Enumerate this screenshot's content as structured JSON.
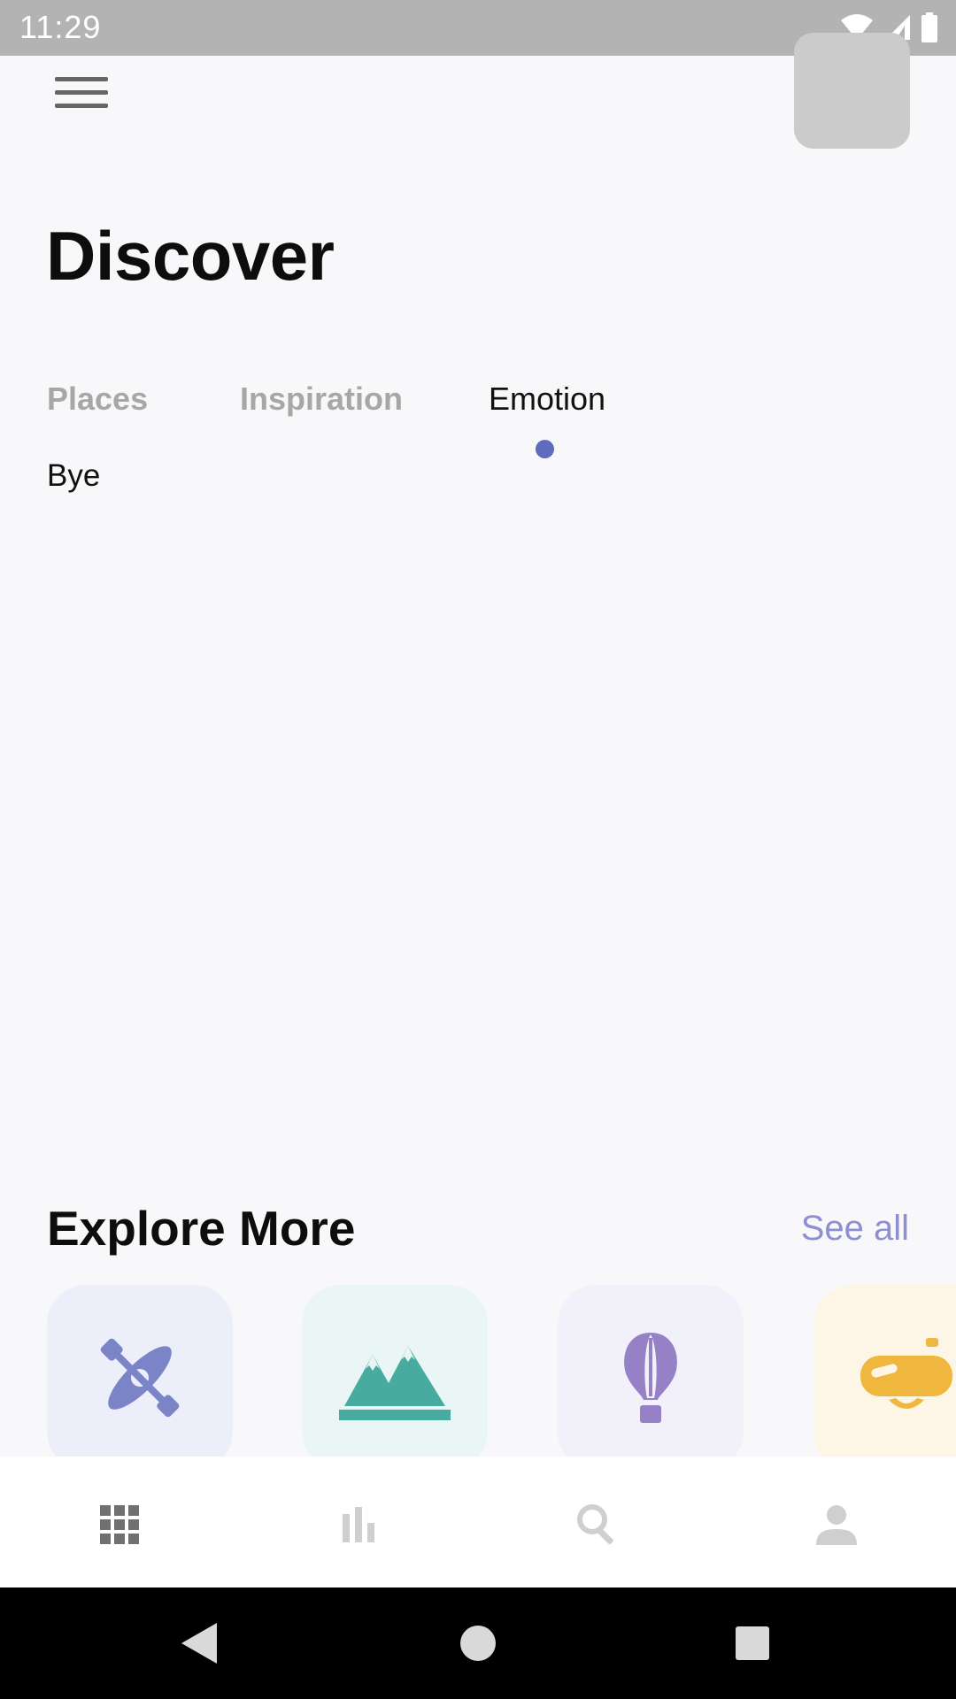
{
  "status_bar": {
    "time": "11:29",
    "icons": [
      "wifi-icon",
      "signal-icon",
      "battery-icon"
    ]
  },
  "header": {
    "menu_icon": "hamburger-menu-icon",
    "title": "Discover"
  },
  "tabs": [
    {
      "label": "Places",
      "active": false
    },
    {
      "label": "Inspiration",
      "active": false
    },
    {
      "label": "Emotion",
      "active": true
    }
  ],
  "tab_content": {
    "text": "Bye"
  },
  "explore": {
    "title": "Explore More",
    "see_all": "See all",
    "cards": [
      {
        "icon": "kayak-icon",
        "color": "#7b84c6",
        "bg": "#eceffa"
      },
      {
        "icon": "mountains-icon",
        "color": "#47aba0",
        "bg": "#eaf6f5"
      },
      {
        "icon": "hot-air-balloon-icon",
        "color": "#9680c6",
        "bg": "#f2f1f9"
      },
      {
        "icon": "diving-mask-icon",
        "color": "#f0b73e",
        "bg": "#fdf6e6"
      }
    ]
  },
  "bottom_nav": [
    {
      "icon": "grid-apps-icon",
      "active": true
    },
    {
      "icon": "bar-chart-icon",
      "active": false
    },
    {
      "icon": "search-icon",
      "active": false
    },
    {
      "icon": "person-icon",
      "active": false
    }
  ],
  "colors": {
    "accent": "#5f6bbf",
    "see_all": "#8d8fd0",
    "inactive_tab": "#a7a7a7",
    "status_bar": "#b3b3b3"
  }
}
